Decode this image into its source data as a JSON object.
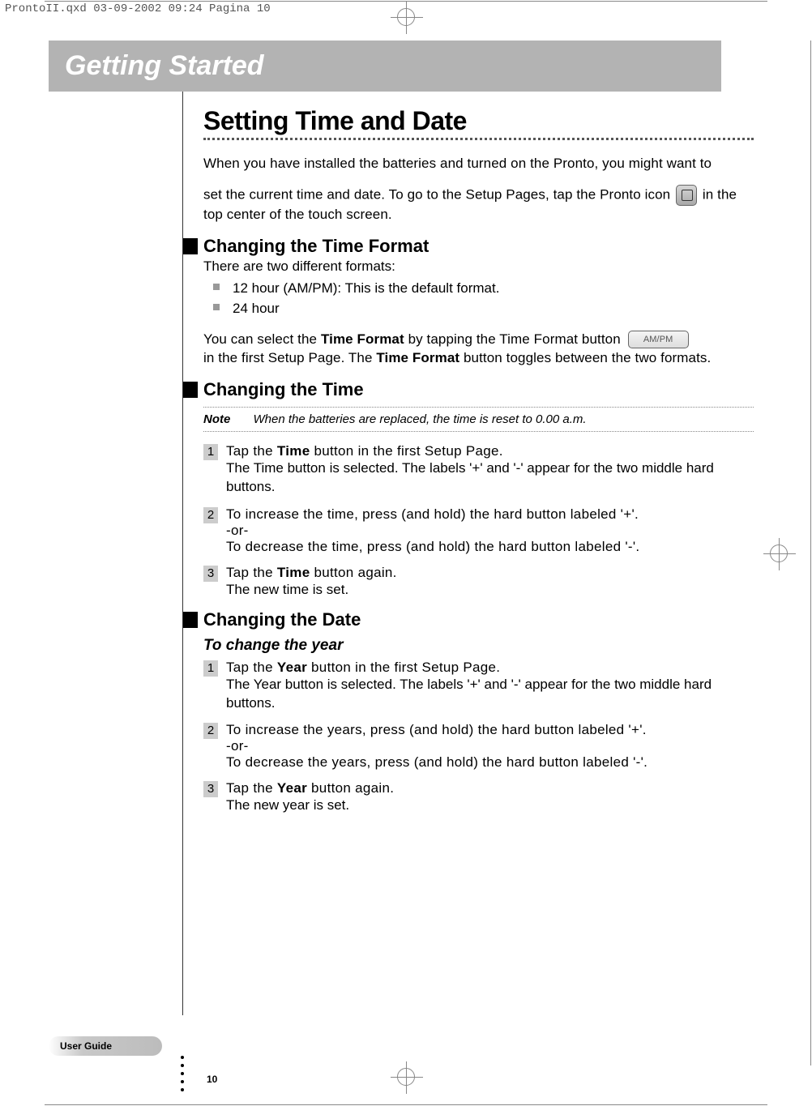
{
  "topbar": "ProntoII.qxd  03-09-2002  09:24  Pagina 10",
  "chapter_title": "Getting Started",
  "section_title": "Setting Time and Date",
  "intro_1": "When you have installed the batteries and turned on the Pronto, you might want to",
  "intro_2a": "set the current time and date. To go to the Setup Pages, tap the Pronto icon ",
  "intro_2b": " in the top center of the touch screen.",
  "sub1_title": "Changing the Time Format",
  "sub1_intro": "There are two different formats:",
  "bullets": [
    "12 hour (AM/PM): This is the default format.",
    "24 hour"
  ],
  "sub1_p_a": "You can select the ",
  "sub1_p_b": "Time Format",
  "sub1_p_c": " by tapping the Time Format button ",
  "ampm_label": "AM/PM",
  "sub1_p_d": "in the first Setup Page. The ",
  "sub1_p_e": "Time Format",
  "sub1_p_f": " button toggles between the two formats.",
  "sub2_title": "Changing the Time",
  "note_label": "Note",
  "note_text": "When the batteries are replaced, the time is reset to 0.00 a.m.",
  "time_steps": [
    {
      "num": "1",
      "main_a": "Tap the ",
      "main_b": "Time",
      "main_c": " button in the first Setup Page.",
      "sub": "The Time button is selected. The labels '+' and '-' appear for the two middle hard buttons."
    },
    {
      "num": "2",
      "main": "To increase the time, press (and hold) the hard button labeled '+'.",
      "or": "-or-",
      "main2": "To decrease the time, press (and hold) the hard button labeled '-'."
    },
    {
      "num": "3",
      "main_a": "Tap the ",
      "main_b": "Time",
      "main_c": " button again.",
      "sub": "The new time is set."
    }
  ],
  "sub3_title": "Changing the Date",
  "sub3_sub": "To change the year",
  "year_steps": [
    {
      "num": "1",
      "main_a": "Tap the ",
      "main_b": "Year",
      "main_c": " button in the first Setup Page.",
      "sub": "The Year button is selected. The labels '+' and '-' appear for the two middle hard buttons."
    },
    {
      "num": "2",
      "main": "To increase the years, press (and hold) the hard button labeled '+'.",
      "or": "-or-",
      "main2": "To decrease the years, press (and hold) the hard button labeled '-'."
    },
    {
      "num": "3",
      "main_a": "Tap the ",
      "main_b": "Year",
      "main_c": " button again.",
      "sub": "The new year is set."
    }
  ],
  "footer_label": "User Guide",
  "page_number": "10"
}
